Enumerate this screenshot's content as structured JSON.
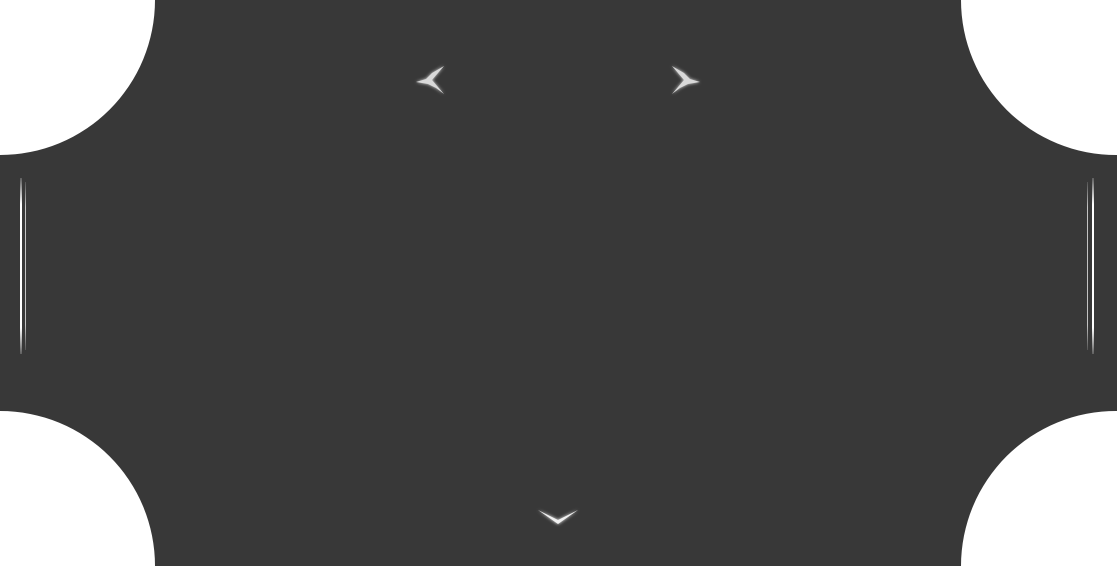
{
  "panel": {
    "background_color": "#383838",
    "page_background_color": "#ffffff",
    "accent_color": "#e6e6e6"
  },
  "header": {
    "prev_icon": "fish-arrow-left-icon",
    "next_icon": "fish-arrow-right-icon",
    "title_chars": [
      "",
      ""
    ]
  },
  "footer": {
    "toggle_icon": "chevron-down-icon"
  }
}
